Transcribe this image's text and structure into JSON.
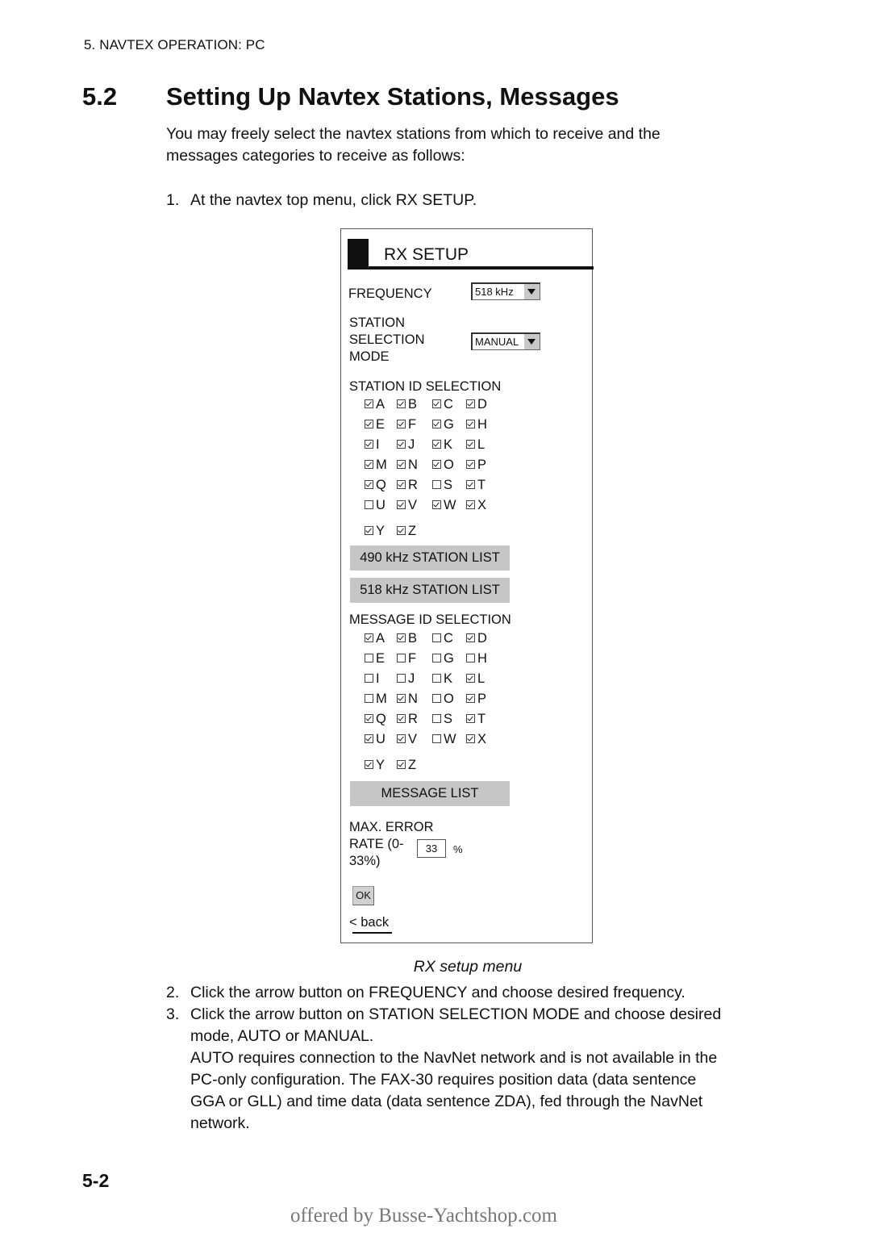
{
  "running_head": "5. NAVTEX OPERATION: PC",
  "section": {
    "number": "5.2",
    "title": "Setting Up Navtex Stations, Messages"
  },
  "intro_lines": [
    "You may freely select the navtex stations from which to receive and the",
    "messages categories to receive as follows:"
  ],
  "step1": {
    "n": "1.",
    "text": "At the navtex top menu, click RX SETUP."
  },
  "rx_setup": {
    "title": "RX SETUP",
    "frequency": {
      "label": "FREQUENCY",
      "value": "518 kHz"
    },
    "station_mode": {
      "label_lines": [
        "STATION",
        "SELECTION",
        "MODE"
      ],
      "value": "MANUAL"
    },
    "station_id": {
      "label": "STATION ID SELECTION",
      "items": [
        {
          "l": "A",
          "c": true
        },
        {
          "l": "B",
          "c": true
        },
        {
          "l": "C",
          "c": true
        },
        {
          "l": "D",
          "c": true
        },
        {
          "l": "E",
          "c": true
        },
        {
          "l": "F",
          "c": true
        },
        {
          "l": "G",
          "c": true
        },
        {
          "l": "H",
          "c": true
        },
        {
          "l": "I",
          "c": true
        },
        {
          "l": "J",
          "c": true
        },
        {
          "l": "K",
          "c": true
        },
        {
          "l": "L",
          "c": true
        },
        {
          "l": "M",
          "c": true
        },
        {
          "l": "N",
          "c": true
        },
        {
          "l": "O",
          "c": true
        },
        {
          "l": "P",
          "c": true
        },
        {
          "l": "Q",
          "c": true
        },
        {
          "l": "R",
          "c": true
        },
        {
          "l": "S",
          "c": false
        },
        {
          "l": "T",
          "c": true
        },
        {
          "l": "U",
          "c": false
        },
        {
          "l": "V",
          "c": true
        },
        {
          "l": "W",
          "c": true
        },
        {
          "l": "X",
          "c": true
        },
        {
          "l": "Y",
          "c": true
        },
        {
          "l": "Z",
          "c": true
        }
      ]
    },
    "btn_490": "490 kHz STATION LIST",
    "btn_518": "518 kHz STATION LIST",
    "message_id": {
      "label": "MESSAGE ID SELECTION",
      "items": [
        {
          "l": "A",
          "c": true
        },
        {
          "l": "B",
          "c": true
        },
        {
          "l": "C",
          "c": false
        },
        {
          "l": "D",
          "c": true
        },
        {
          "l": "E",
          "c": false
        },
        {
          "l": "F",
          "c": false
        },
        {
          "l": "G",
          "c": false
        },
        {
          "l": "H",
          "c": false
        },
        {
          "l": "I",
          "c": false
        },
        {
          "l": "J",
          "c": false
        },
        {
          "l": "K",
          "c": false
        },
        {
          "l": "L",
          "c": true
        },
        {
          "l": "M",
          "c": false
        },
        {
          "l": "N",
          "c": true
        },
        {
          "l": "O",
          "c": false
        },
        {
          "l": "P",
          "c": true
        },
        {
          "l": "Q",
          "c": true
        },
        {
          "l": "R",
          "c": true
        },
        {
          "l": "S",
          "c": false
        },
        {
          "l": "T",
          "c": true
        },
        {
          "l": "U",
          "c": true
        },
        {
          "l": "V",
          "c": true
        },
        {
          "l": "W",
          "c": false
        },
        {
          "l": "X",
          "c": true
        },
        {
          "l": "Y",
          "c": true
        },
        {
          "l": "Z",
          "c": true
        }
      ]
    },
    "btn_message_list": "MESSAGE LIST",
    "error_rate": {
      "label_lines": [
        "MAX. ERROR",
        "RATE (0-",
        "33%)"
      ],
      "value": "33",
      "unit": "%"
    },
    "ok": "OK",
    "back": "< back"
  },
  "caption": "RX setup menu",
  "steps": [
    {
      "n": "2.",
      "lines": [
        "Click the arrow button on FREQUENCY and choose desired frequency."
      ]
    },
    {
      "n": "3.",
      "lines": [
        "Click the arrow button on STATION SELECTION MODE and choose desired",
        "mode, AUTO or MANUAL.",
        "AUTO requires connection to the NavNet network and is not available in the",
        "PC-only configuration. The FAX-30 requires position data (data sentence",
        "GGA or GLL) and time data (data sentence ZDA), fed through the NavNet",
        "network."
      ]
    }
  ],
  "page_number": "5-2",
  "footer": "offered by Busse-Yachtshop.com"
}
